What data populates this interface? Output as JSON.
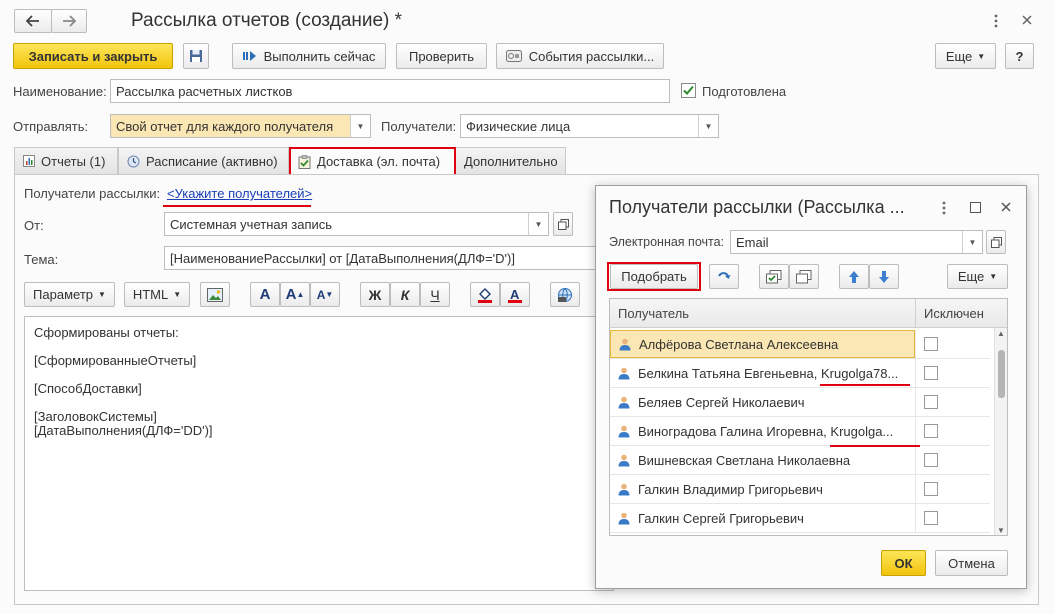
{
  "window": {
    "title": "Рассылка отчетов (создание) *",
    "back_icon": "arrow-left-icon",
    "forward_icon": "arrow-right-icon"
  },
  "toolbar": {
    "save_close": "Записать и закрыть",
    "run_now": "Выполнить сейчас",
    "check": "Проверить",
    "events": "События рассылки...",
    "more": "Еще",
    "help": "?"
  },
  "form": {
    "name_label": "Наименование:",
    "name_value": "Рассылка расчетных листков",
    "prepared_label": "Подготовлена",
    "prepared_checked": true,
    "send_label": "Отправлять:",
    "send_value": "Свой отчет для каждого получателя",
    "recipients_label": "Получатели:",
    "recipients_value": "Физические лица"
  },
  "tabs": [
    {
      "label": "Отчеты (1)"
    },
    {
      "label": "Расписание (активно)"
    },
    {
      "label": "Доставка (эл. почта)"
    },
    {
      "label": "Дополнительно"
    }
  ],
  "delivery": {
    "recipients_label": "Получатели рассылки:",
    "recipients_link": "<Укажите получателей>",
    "from_label": "От:",
    "from_value": "Системная учетная запись",
    "subject_label": "Тема:",
    "subject_value": "[НаименованиеРассылки] от [ДатаВыполнения(ДЛФ='D')]",
    "param_button": "Параметр",
    "html_button": "HTML",
    "bold": "Ж",
    "italic": "К",
    "underline": "Ч",
    "body_lines": [
      "Сформированы отчеты:",
      "",
      "[СформированныеОтчеты]",
      "",
      "[СпособДоставки]",
      "",
      "[ЗаголовокСистемы]",
      "[ДатаВыполнения(ДЛФ='DD')]"
    ]
  },
  "dialog": {
    "title": "Получатели рассылки (Рассылка ...",
    "email_label": "Электронная почта:",
    "email_value": "Email",
    "pick_button": "Подобрать",
    "more_button": "Еще",
    "col_recipient": "Получатель",
    "col_excluded": "Исключен",
    "rows": [
      {
        "name": "Алфёрова Светлана Алексеевна",
        "excluded": false
      },
      {
        "name": "Белкина Татьяна Евгеньевна, Krugolga78...",
        "excluded": false
      },
      {
        "name": "Беляев Сергей Николаевич",
        "excluded": false
      },
      {
        "name": "Виноградова Галина Игоревна, Krugolga...",
        "excluded": false
      },
      {
        "name": "Вишневская Светлана Николаевна",
        "excluded": false
      },
      {
        "name": "Галкин Владимир Григорьевич",
        "excluded": false
      },
      {
        "name": "Галкин Сергей Григорьевич",
        "excluded": false
      }
    ],
    "ok": "ОК",
    "cancel": "Отмена"
  },
  "colors": {
    "accent_yellow": "#f5cd1c",
    "highlight_red": "#e0000f",
    "link_blue": "#1a3fb8"
  }
}
